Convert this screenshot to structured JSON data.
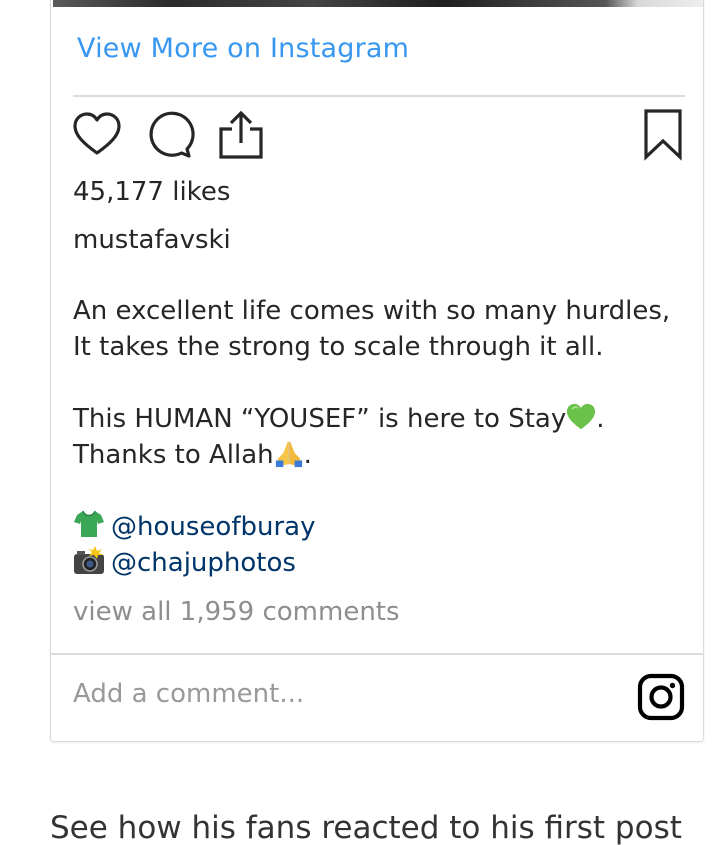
{
  "embed": {
    "view_more_label": "View More on Instagram",
    "likes_text": "45,177 likes",
    "username": "mustafavski",
    "caption": {
      "line1": "An excellent life comes with so many hurdles,",
      "line2": "It takes the strong to scale through it all.",
      "line3": "This HUMAN “YOUSEF” is here to Stay",
      "line3_end": ".",
      "line4": "Thanks to Allah",
      "line4_end": "."
    },
    "credits": [
      {
        "icon": "tshirt-emoji",
        "handle": "@houseofburay"
      },
      {
        "icon": "camera-flash-emoji",
        "handle": "@chajuphotos"
      }
    ],
    "view_comments_label": "view all 1,959 comments",
    "comment_placeholder": "Add a comment...",
    "icons": [
      "heart-icon",
      "comment-icon",
      "share-icon",
      "bookmark-icon",
      "instagram-logo-icon"
    ],
    "colors": {
      "link": "#3897f0",
      "mention": "#003569",
      "muted": "#8e8e8e",
      "text": "#262626",
      "border": "#dbdbdb"
    }
  },
  "article": {
    "subheading": "See how his fans reacted to his first post"
  }
}
